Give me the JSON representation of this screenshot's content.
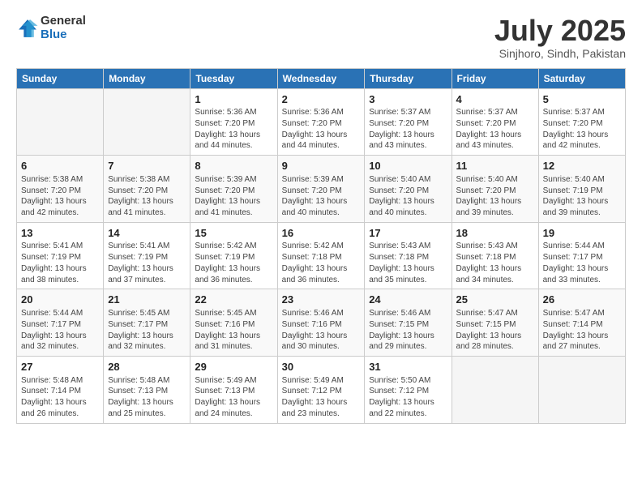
{
  "logo": {
    "general": "General",
    "blue": "Blue"
  },
  "title": "July 2025",
  "subtitle": "Sinjhoro, Sindh, Pakistan",
  "weekdays": [
    "Sunday",
    "Monday",
    "Tuesday",
    "Wednesday",
    "Thursday",
    "Friday",
    "Saturday"
  ],
  "weeks": [
    [
      {
        "day": "",
        "info": ""
      },
      {
        "day": "",
        "info": ""
      },
      {
        "day": "1",
        "info": "Sunrise: 5:36 AM\nSunset: 7:20 PM\nDaylight: 13 hours and 44 minutes."
      },
      {
        "day": "2",
        "info": "Sunrise: 5:36 AM\nSunset: 7:20 PM\nDaylight: 13 hours and 44 minutes."
      },
      {
        "day": "3",
        "info": "Sunrise: 5:37 AM\nSunset: 7:20 PM\nDaylight: 13 hours and 43 minutes."
      },
      {
        "day": "4",
        "info": "Sunrise: 5:37 AM\nSunset: 7:20 PM\nDaylight: 13 hours and 43 minutes."
      },
      {
        "day": "5",
        "info": "Sunrise: 5:37 AM\nSunset: 7:20 PM\nDaylight: 13 hours and 42 minutes."
      }
    ],
    [
      {
        "day": "6",
        "info": "Sunrise: 5:38 AM\nSunset: 7:20 PM\nDaylight: 13 hours and 42 minutes."
      },
      {
        "day": "7",
        "info": "Sunrise: 5:38 AM\nSunset: 7:20 PM\nDaylight: 13 hours and 41 minutes."
      },
      {
        "day": "8",
        "info": "Sunrise: 5:39 AM\nSunset: 7:20 PM\nDaylight: 13 hours and 41 minutes."
      },
      {
        "day": "9",
        "info": "Sunrise: 5:39 AM\nSunset: 7:20 PM\nDaylight: 13 hours and 40 minutes."
      },
      {
        "day": "10",
        "info": "Sunrise: 5:40 AM\nSunset: 7:20 PM\nDaylight: 13 hours and 40 minutes."
      },
      {
        "day": "11",
        "info": "Sunrise: 5:40 AM\nSunset: 7:20 PM\nDaylight: 13 hours and 39 minutes."
      },
      {
        "day": "12",
        "info": "Sunrise: 5:40 AM\nSunset: 7:19 PM\nDaylight: 13 hours and 39 minutes."
      }
    ],
    [
      {
        "day": "13",
        "info": "Sunrise: 5:41 AM\nSunset: 7:19 PM\nDaylight: 13 hours and 38 minutes."
      },
      {
        "day": "14",
        "info": "Sunrise: 5:41 AM\nSunset: 7:19 PM\nDaylight: 13 hours and 37 minutes."
      },
      {
        "day": "15",
        "info": "Sunrise: 5:42 AM\nSunset: 7:19 PM\nDaylight: 13 hours and 36 minutes."
      },
      {
        "day": "16",
        "info": "Sunrise: 5:42 AM\nSunset: 7:18 PM\nDaylight: 13 hours and 36 minutes."
      },
      {
        "day": "17",
        "info": "Sunrise: 5:43 AM\nSunset: 7:18 PM\nDaylight: 13 hours and 35 minutes."
      },
      {
        "day": "18",
        "info": "Sunrise: 5:43 AM\nSunset: 7:18 PM\nDaylight: 13 hours and 34 minutes."
      },
      {
        "day": "19",
        "info": "Sunrise: 5:44 AM\nSunset: 7:17 PM\nDaylight: 13 hours and 33 minutes."
      }
    ],
    [
      {
        "day": "20",
        "info": "Sunrise: 5:44 AM\nSunset: 7:17 PM\nDaylight: 13 hours and 32 minutes."
      },
      {
        "day": "21",
        "info": "Sunrise: 5:45 AM\nSunset: 7:17 PM\nDaylight: 13 hours and 32 minutes."
      },
      {
        "day": "22",
        "info": "Sunrise: 5:45 AM\nSunset: 7:16 PM\nDaylight: 13 hours and 31 minutes."
      },
      {
        "day": "23",
        "info": "Sunrise: 5:46 AM\nSunset: 7:16 PM\nDaylight: 13 hours and 30 minutes."
      },
      {
        "day": "24",
        "info": "Sunrise: 5:46 AM\nSunset: 7:15 PM\nDaylight: 13 hours and 29 minutes."
      },
      {
        "day": "25",
        "info": "Sunrise: 5:47 AM\nSunset: 7:15 PM\nDaylight: 13 hours and 28 minutes."
      },
      {
        "day": "26",
        "info": "Sunrise: 5:47 AM\nSunset: 7:14 PM\nDaylight: 13 hours and 27 minutes."
      }
    ],
    [
      {
        "day": "27",
        "info": "Sunrise: 5:48 AM\nSunset: 7:14 PM\nDaylight: 13 hours and 26 minutes."
      },
      {
        "day": "28",
        "info": "Sunrise: 5:48 AM\nSunset: 7:13 PM\nDaylight: 13 hours and 25 minutes."
      },
      {
        "day": "29",
        "info": "Sunrise: 5:49 AM\nSunset: 7:13 PM\nDaylight: 13 hours and 24 minutes."
      },
      {
        "day": "30",
        "info": "Sunrise: 5:49 AM\nSunset: 7:12 PM\nDaylight: 13 hours and 23 minutes."
      },
      {
        "day": "31",
        "info": "Sunrise: 5:50 AM\nSunset: 7:12 PM\nDaylight: 13 hours and 22 minutes."
      },
      {
        "day": "",
        "info": ""
      },
      {
        "day": "",
        "info": ""
      }
    ]
  ]
}
